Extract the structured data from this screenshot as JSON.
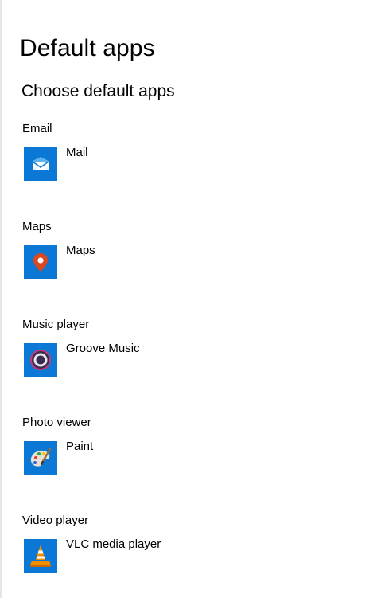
{
  "page": {
    "title": "Default apps",
    "section_title": "Choose default apps"
  },
  "categories": [
    {
      "label": "Email",
      "app": {
        "name": "Mail",
        "icon": "mail-icon"
      }
    },
    {
      "label": "Maps",
      "app": {
        "name": "Maps",
        "icon": "maps-icon"
      }
    },
    {
      "label": "Music player",
      "app": {
        "name": "Groove Music",
        "icon": "groove-music-icon"
      }
    },
    {
      "label": "Photo viewer",
      "app": {
        "name": "Paint",
        "icon": "paint-icon"
      }
    },
    {
      "label": "Video player",
      "app": {
        "name": "VLC media player",
        "icon": "vlc-icon"
      }
    }
  ],
  "colors": {
    "tile_blue": "#0a78d4",
    "maps_pin": "#d9481f",
    "vlc_orange": "#f28c00"
  }
}
